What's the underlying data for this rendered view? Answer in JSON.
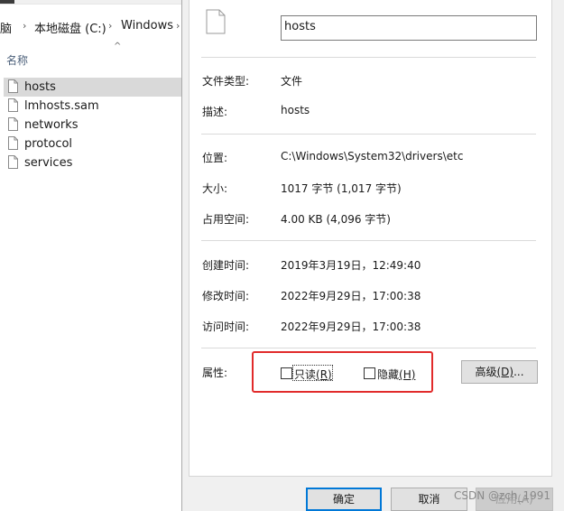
{
  "explorer": {
    "breadcrumb": [
      "脑",
      "本地磁盘 (C:)",
      "Windows"
    ],
    "column_header": "名称",
    "files": [
      {
        "name": "hosts",
        "selected": true
      },
      {
        "name": "lmhosts.sam",
        "selected": false
      },
      {
        "name": "networks",
        "selected": false
      },
      {
        "name": "protocol",
        "selected": false
      },
      {
        "name": "services",
        "selected": false
      }
    ],
    "selected_bg": "#d9d9d9"
  },
  "dialog": {
    "file_name": "hosts",
    "rows": [
      {
        "label": "文件类型:",
        "value": "文件"
      },
      {
        "label": "描述:",
        "value": "hosts"
      },
      {
        "label": "位置:",
        "value": "C:\\Windows\\System32\\drivers\\etc"
      },
      {
        "label": "大小:",
        "value": "1017 字节 (1,017 字节)"
      },
      {
        "label": "占用空间:",
        "value": "4.00 KB (4,096 字节)"
      },
      {
        "label": "创建时间:",
        "value": "2019年3月19日，12:49:40"
      },
      {
        "label": "修改时间:",
        "value": "2022年9月29日，17:00:38"
      },
      {
        "label": "访问时间:",
        "value": "2022年9月29日，17:00:38"
      }
    ],
    "attributes": {
      "label": "属性:",
      "readonly": {
        "text": "只读",
        "mnemonic": "(R)",
        "checked": false
      },
      "hidden": {
        "text": "隐藏",
        "mnemonic": "(H)",
        "checked": false
      },
      "advanced": {
        "text": "高级",
        "mnemonic": "(D)",
        "suffix": "..."
      }
    },
    "buttons": {
      "ok": "确定",
      "cancel": "取消",
      "apply": "应用(A)"
    }
  },
  "colors": {
    "highlight": "#e12b2b",
    "focus_border": "#0078d7"
  },
  "watermark": "CSDN @zch_1991"
}
